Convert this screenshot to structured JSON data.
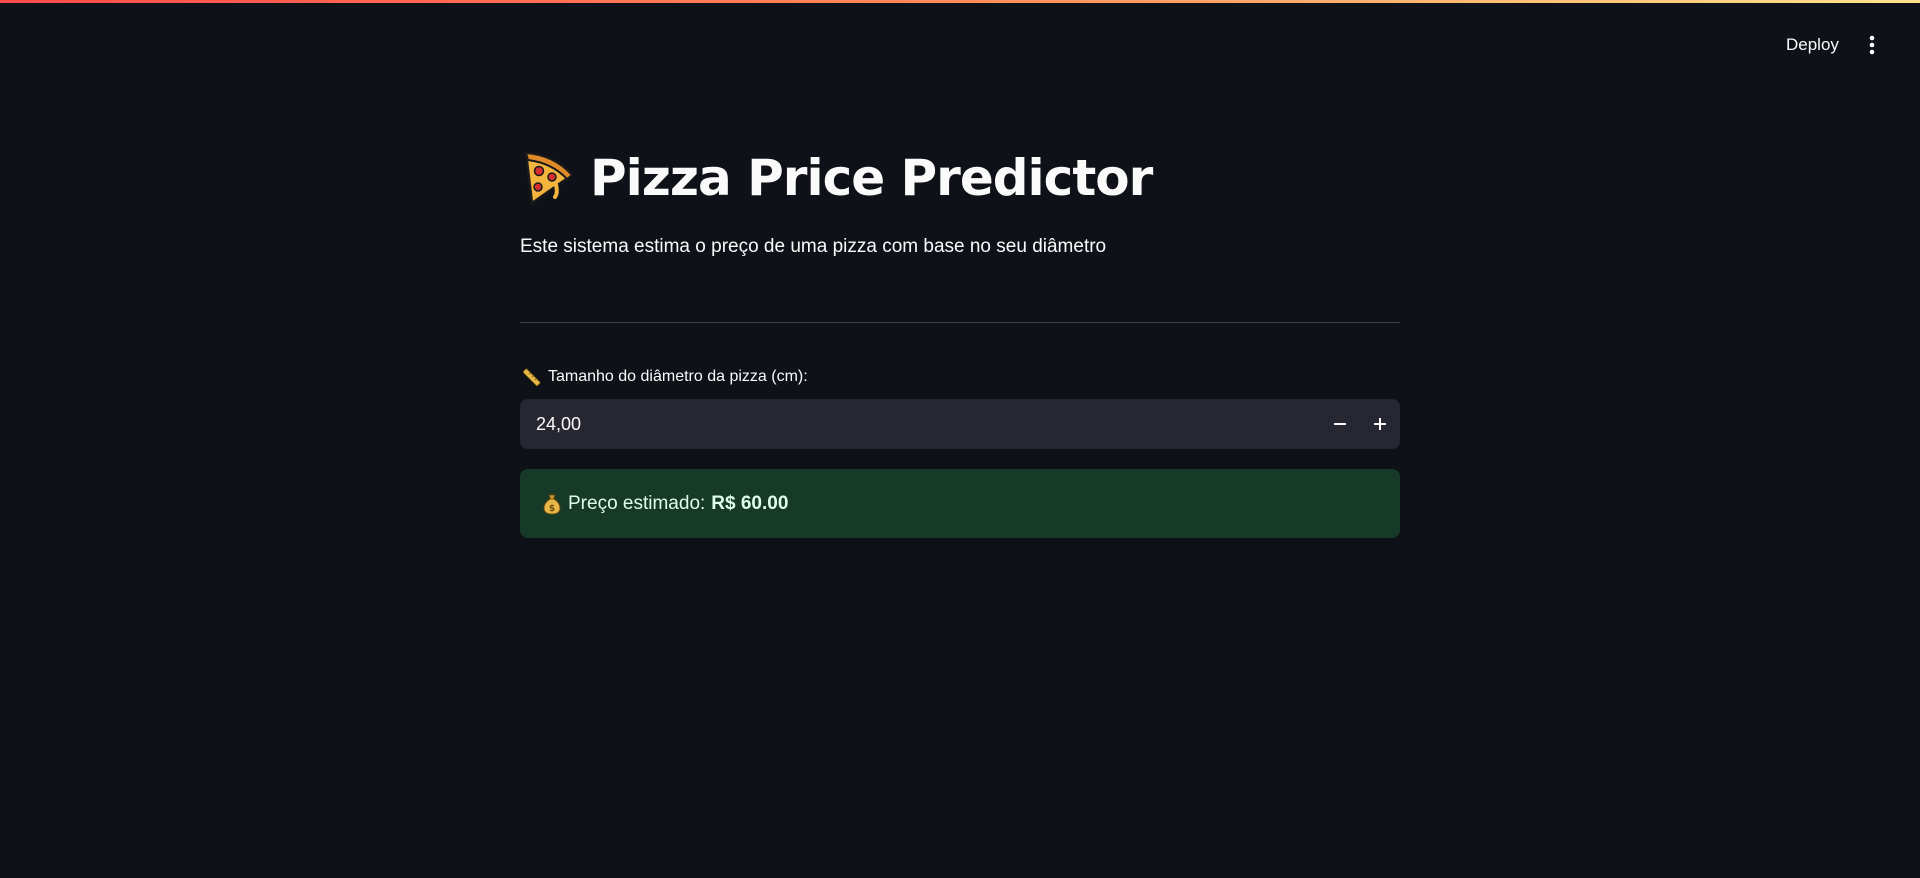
{
  "header": {
    "deploy_label": "Deploy",
    "menu_icon": "vertical-dots-icon"
  },
  "main": {
    "title_icon": "pizza-icon",
    "title": "Pizza Price Predictor",
    "description": "Este sistema estima o preço de uma pizza com base no seu diâmetro",
    "input": {
      "label_icon": "ruler-icon",
      "label": "Tamanho do diâmetro da pizza (cm):",
      "value": "24,00",
      "decrement_icon": "minus-icon",
      "increment_icon": "plus-icon"
    },
    "result": {
      "icon": "money-bag-icon",
      "label": "Preço estimado:",
      "value": "R$ 60.00"
    }
  },
  "colors": {
    "background": "#0e1117",
    "input_background": "#262730",
    "success_background": "#173928",
    "success_text": "#dffde9",
    "divider": "#3d4049",
    "accent_gradient_start": "#ff4b4b",
    "accent_gradient_end": "#ffe38b"
  }
}
